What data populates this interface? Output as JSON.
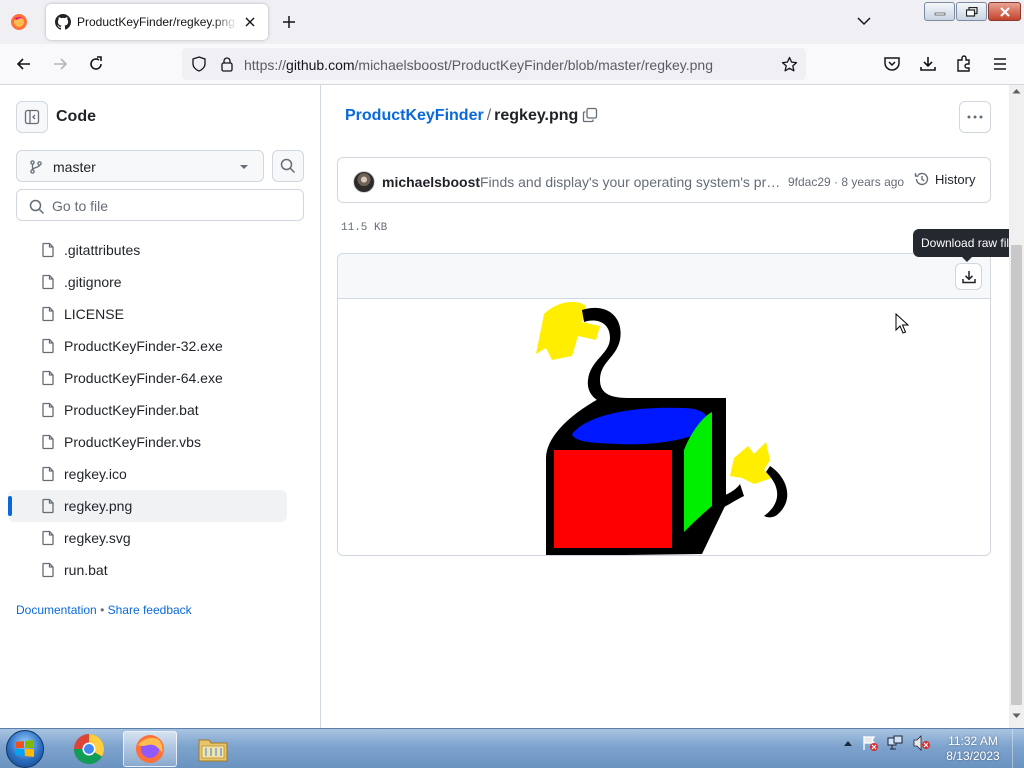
{
  "browser": {
    "tab_title": "ProductKeyFinder/regkey.png at master",
    "url_prefix": "https://",
    "url_domain": "github.com",
    "url_path": "/michaelsboost/ProductKeyFinder/blob/master/regkey.png"
  },
  "sidebar": {
    "title": "Code",
    "branch": "master",
    "search_placeholder": "Go to file",
    "files": [
      {
        "name": ".gitattributes",
        "selected": false
      },
      {
        "name": ".gitignore",
        "selected": false
      },
      {
        "name": "LICENSE",
        "selected": false
      },
      {
        "name": "ProductKeyFinder-32.exe",
        "selected": false
      },
      {
        "name": "ProductKeyFinder-64.exe",
        "selected": false
      },
      {
        "name": "ProductKeyFinder.bat",
        "selected": false
      },
      {
        "name": "ProductKeyFinder.vbs",
        "selected": false
      },
      {
        "name": "regkey.ico",
        "selected": false
      },
      {
        "name": "regkey.png",
        "selected": true
      },
      {
        "name": "regkey.svg",
        "selected": false
      },
      {
        "name": "run.bat",
        "selected": false
      }
    ],
    "footer": {
      "documentation": "Documentation",
      "separator": "•",
      "feedback": "Share feedback"
    }
  },
  "main": {
    "repo": "ProductKeyFinder",
    "separator": "/",
    "filename": "regkey.png",
    "commit": {
      "author": "michaelsboost",
      "message": "Finds and display's your operating system's product key",
      "sha": "9fdac29",
      "dot": "·",
      "age": "8 years ago",
      "history_label": "History"
    },
    "file_size": "11.5 KB",
    "tooltip": "Download raw file"
  },
  "taskbar": {
    "time": "11:32 AM",
    "date": "8/13/2023"
  },
  "colors": {
    "link": "#0969da",
    "border": "#d0d7de",
    "taskbar": "#7da3cd"
  }
}
